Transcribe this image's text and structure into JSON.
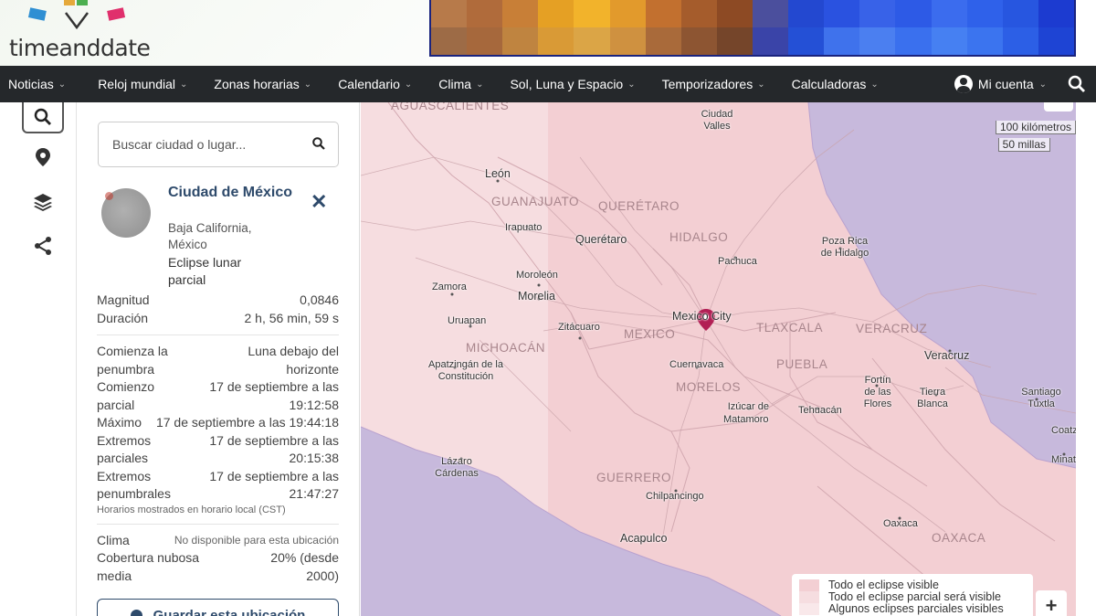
{
  "brand": {
    "name": "timeanddate"
  },
  "nav": {
    "items": [
      "Noticias",
      "Reloj mundial",
      "Zonas horarias",
      "Calendario",
      "Clima",
      "Sol, Luna y Espacio",
      "Temporizadores",
      "Calculadoras"
    ],
    "account": "Mi cuenta"
  },
  "search": {
    "placeholder": "Buscar ciudad o lugar..."
  },
  "location": {
    "name": "Ciudad de México",
    "region": "Baja California, México",
    "event": "Eclipse lunar parcial"
  },
  "details": {
    "magnitude_label": "Magnitud",
    "magnitude_value": "0,0846",
    "duration_label": "Duración",
    "duration_value": "2 h, 56 min, 59 s",
    "penumbral_start_label": "Comienza la penumbra",
    "penumbral_start_value": "Luna debajo del horizonte",
    "partial_start_label": "Comienzo parcial",
    "partial_start_value": "17 de septiembre a las 19:12:58",
    "max_label": "Máximo",
    "max_value": "17 de septiembre a las 19:44:18",
    "partial_end_label": "Extremos parciales",
    "partial_end_value": "17 de septiembre a las 20:15:38",
    "penumbral_end_label": "Extremos penumbrales",
    "penumbral_end_value": "17 de septiembre a las 21:47:27",
    "timezone_note": "Horarios mostrados en horario local (CST)",
    "weather_label": "Clima",
    "weather_value": "No disponible para esta ubicación",
    "cloud_label": "Cobertura nubosa media",
    "cloud_value": "20% (desde 2000)"
  },
  "save_button": "Guardar esta ubicación",
  "map": {
    "scale_km": "100 kilómetros",
    "scale_mi": "50 millas",
    "states": [
      "AGUASCALIENTES",
      "GUANAJUATO",
      "QUERÉTARO",
      "HIDALGO",
      "MICHOACÁN",
      "MEXICO",
      "TLAXCALA",
      "VERACRUZ",
      "PUEBLA",
      "MORELOS",
      "GUERRERO",
      "OAXACA"
    ],
    "cities": [
      "Ciudad Valles",
      "León",
      "Irapuato",
      "Querétaro",
      "Pachuca",
      "Poza Rica de Hidalgo",
      "Moroleón",
      "Zamora",
      "Morelia",
      "Uruapan",
      "Zitácuaro",
      "Mexico City",
      "Veracruz",
      "Apatzingán de la Constitución",
      "Cuernavaca",
      "Izúcar de Matamoros",
      "Tehuacán",
      "Fortín de las Flores",
      "Tierra Blanca",
      "Santiago Tuxtla",
      "Coatzacoalcos",
      "Minatitlán",
      "Lázaro Cárdenas",
      "Chilpancingo",
      "Oaxaca",
      "Acapulco"
    ],
    "legend": [
      "Todo el eclipse visible",
      "Todo el eclipse parcial será visible",
      "Algunos eclipses parciales visibles"
    ],
    "colors": {
      "full": "#f3cfd3",
      "partial": "#f6dde0",
      "ocean": "#c7b9dc"
    }
  }
}
